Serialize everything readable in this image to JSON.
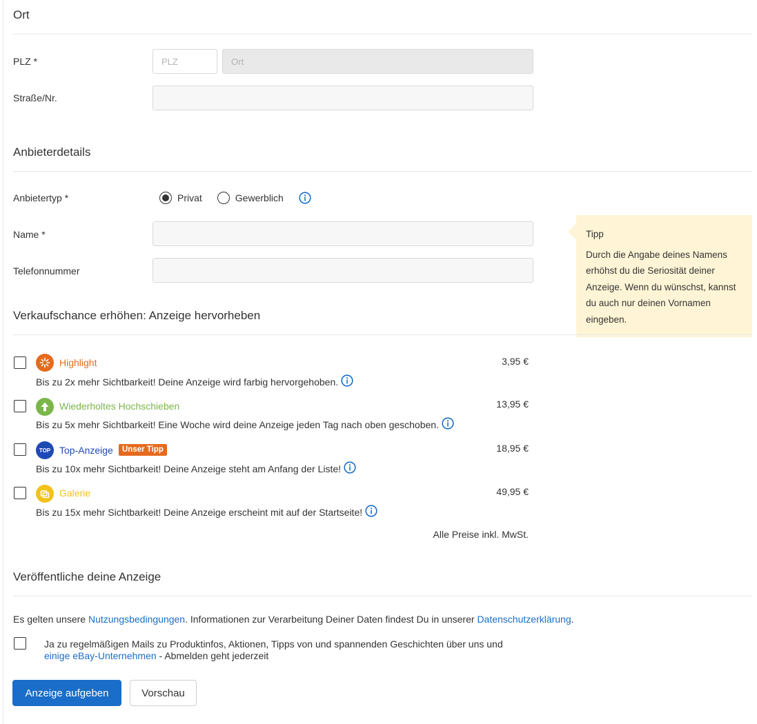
{
  "location": {
    "title": "Ort",
    "plz_label": "PLZ *",
    "plz_placeholder": "PLZ",
    "ort_placeholder": "Ort",
    "street_label": "Straße/Nr."
  },
  "provider": {
    "title": "Anbieterdetails",
    "type_label": "Anbietertyp *",
    "type_options": [
      "Privat",
      "Gewerblich"
    ],
    "selected_type": "Privat",
    "name_label": "Name *",
    "phone_label": "Telefonnummer"
  },
  "tip": {
    "title": "Tipp",
    "text": "Durch die Angabe deines Namens erhöhst du die Seriosität deiner Anzeige. Wenn du wünschst, kannst du auch nur deinen Vornamen eingeben."
  },
  "promote": {
    "title": "Verkaufschance erhöhen: Anzeige hervorheben",
    "features": [
      {
        "name": "Highlight",
        "icon": "sparkle-icon",
        "color": "#e66a1d",
        "desc": "Bis zu 2x mehr Sichtbarkeit! Deine Anzeige wird farbig hervorgehoben.",
        "price": "3,95 €"
      },
      {
        "name": "Wiederholtes Hochschieben",
        "icon": "arrow-up-icon",
        "color": "#7ab648",
        "desc": "Bis zu 5x mehr Sichtbarkeit! Eine Woche wird deine Anzeige jeden Tag nach oben geschoben.",
        "price": "13,95 €"
      },
      {
        "name": "Top-Anzeige",
        "icon": "top-badge-icon",
        "color": "#1f4ab4",
        "badge": "Unser Tipp",
        "desc": "Bis zu 10x mehr Sichtbarkeit! Deine Anzeige steht am Anfang der Liste!",
        "price": "18,95 €"
      },
      {
        "name": "Galerie",
        "icon": "gallery-icon",
        "color": "#f2c21b",
        "desc": "Bis zu 15x mehr Sichtbarkeit! Deine Anzeige erscheint mit auf der Startseite!",
        "price": "49,95 €"
      }
    ],
    "price_note": "Alle Preise inkl. MwSt."
  },
  "publish": {
    "title": "Veröffentliche deine Anzeige",
    "terms_prefix": "Es gelten unsere ",
    "terms_link": "Nutzungsbedingungen",
    "terms_middle": ". Informationen zur Verarbeitung Deiner Daten findest Du in unserer ",
    "privacy_link": "Datenschutzerklärung",
    "terms_suffix": ".",
    "newsletter_line1": "Ja zu regelmäßigen Mails zu Produktinfos, Aktionen, Tipps von und spannenden Geschichten über uns und",
    "newsletter_link": "einige eBay-Unternehmen",
    "newsletter_suffix": " - Abmelden geht jederzeit",
    "submit_label": "Anzeige aufgeben",
    "preview_label": "Vorschau"
  }
}
